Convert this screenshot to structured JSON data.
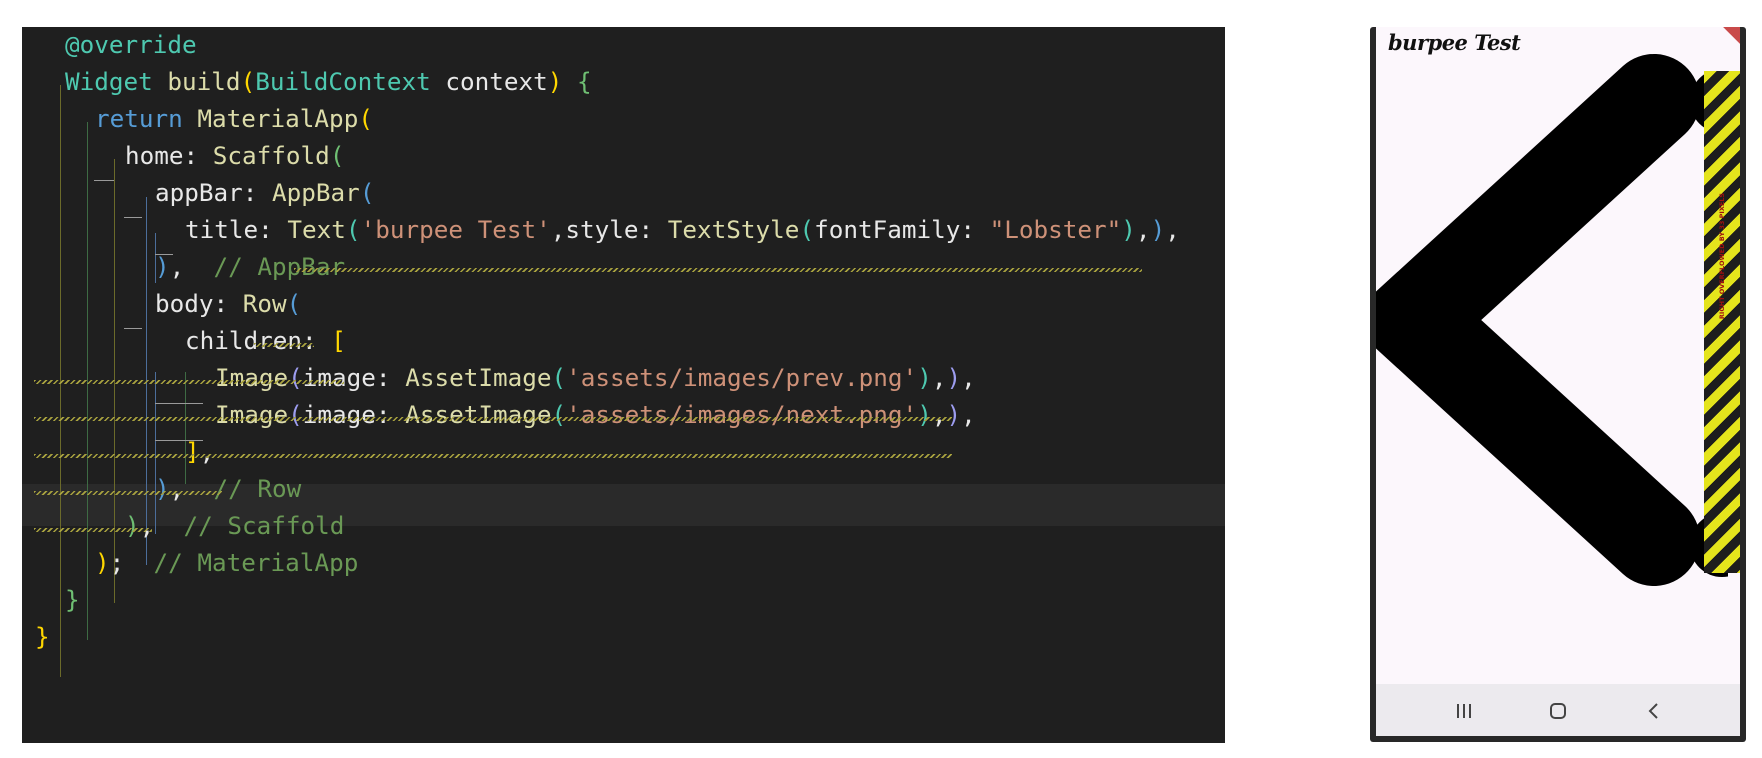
{
  "editor": {
    "lines": [
      {
        "tokens": [
          {
            "t": "@override",
            "c": "at"
          }
        ]
      },
      {
        "tokens": [
          {
            "t": "Widget",
            "c": "ty"
          },
          {
            "t": " build",
            "c": "fn"
          },
          {
            "t": "(",
            "c": "p1"
          },
          {
            "t": "BuildContext",
            "c": "ty"
          },
          {
            "t": " context",
            "c": "id"
          },
          {
            "t": ")",
            "c": "p1"
          },
          {
            "t": " {",
            "c": "p3"
          }
        ]
      },
      {
        "tokens": [
          {
            "t": "return",
            "c": "kw2"
          },
          {
            "t": " MaterialApp",
            "c": "fn"
          },
          {
            "t": "(",
            "c": "p1"
          }
        ]
      },
      {
        "tokens": [
          {
            "t": "home",
            "c": "id"
          },
          {
            "t": ": ",
            "c": "id"
          },
          {
            "t": "Scaffold",
            "c": "fn"
          },
          {
            "t": "(",
            "c": "p3"
          }
        ]
      },
      {
        "tokens": [
          {
            "t": "appBar",
            "c": "id"
          },
          {
            "t": ": ",
            "c": "id"
          },
          {
            "t": "AppBar",
            "c": "fn"
          },
          {
            "t": "(",
            "c": "p2"
          }
        ]
      },
      {
        "tokens": [
          {
            "t": "title",
            "c": "id"
          },
          {
            "t": ": ",
            "c": "id"
          },
          {
            "t": "Text",
            "c": "fn"
          },
          {
            "t": "(",
            "c": "p6"
          },
          {
            "t": "'burpee Test'",
            "c": "st"
          },
          {
            "t": ",",
            "c": "id"
          },
          {
            "t": "style",
            "c": "id"
          },
          {
            "t": ": ",
            "c": "id"
          },
          {
            "t": "TextStyle",
            "c": "fn"
          },
          {
            "t": "(",
            "c": "p6"
          },
          {
            "t": "fontFamily",
            "c": "id"
          },
          {
            "t": ": ",
            "c": "id"
          },
          {
            "t": "\"Lobster\"",
            "c": "st"
          },
          {
            "t": ")",
            "c": "p6"
          },
          {
            "t": ",",
            "c": "id"
          },
          {
            "t": ")",
            "c": "p2"
          },
          {
            "t": ",",
            "c": "id"
          }
        ]
      },
      {
        "tokens": [
          {
            "t": ")",
            "c": "p2"
          },
          {
            "t": ",  ",
            "c": "id"
          },
          {
            "t": "// AppBar",
            "c": "cm"
          }
        ]
      },
      {
        "tokens": [
          {
            "t": "body",
            "c": "id"
          },
          {
            "t": ": ",
            "c": "id"
          },
          {
            "t": "Row",
            "c": "fn"
          },
          {
            "t": "(",
            "c": "p2"
          }
        ]
      },
      {
        "tokens": [
          {
            "t": "children",
            "c": "id"
          },
          {
            "t": ": ",
            "c": "id"
          },
          {
            "t": "[",
            "c": "p1"
          }
        ]
      },
      {
        "tokens": [
          {
            "t": "Image",
            "c": "fn"
          },
          {
            "t": "(",
            "c": "p5"
          },
          {
            "t": "image",
            "c": "id"
          },
          {
            "t": ": ",
            "c": "id"
          },
          {
            "t": "AssetImage",
            "c": "fn"
          },
          {
            "t": "(",
            "c": "p6"
          },
          {
            "t": "'assets/images/prev.png'",
            "c": "st"
          },
          {
            "t": ")",
            "c": "p6"
          },
          {
            "t": ",",
            "c": "id"
          },
          {
            "t": ")",
            "c": "p5"
          },
          {
            "t": ",",
            "c": "id"
          }
        ]
      },
      {
        "tokens": [
          {
            "t": "Image",
            "c": "fn"
          },
          {
            "t": "(",
            "c": "p5"
          },
          {
            "t": "image",
            "c": "id"
          },
          {
            "t": ": ",
            "c": "id"
          },
          {
            "t": "AssetImage",
            "c": "fn"
          },
          {
            "t": "(",
            "c": "p6"
          },
          {
            "t": "'assets/images/next.png'",
            "c": "st"
          },
          {
            "t": ")",
            "c": "p6"
          },
          {
            "t": ",",
            "c": "id"
          },
          {
            "t": ")",
            "c": "p5"
          },
          {
            "t": ",",
            "c": "id"
          }
        ]
      },
      {
        "tokens": [
          {
            "t": "]",
            "c": "p1"
          },
          {
            "t": ",",
            "c": "id"
          }
        ]
      },
      {
        "tokens": [
          {
            "t": ")",
            "c": "p2"
          },
          {
            "t": ",  ",
            "c": "id"
          },
          {
            "t": "// Row",
            "c": "cm"
          }
        ]
      },
      {
        "tokens": [
          {
            "t": ")",
            "c": "p3"
          },
          {
            "t": ",  ",
            "c": "id"
          },
          {
            "t": "// Scaffold",
            "c": "cm"
          }
        ]
      },
      {
        "tokens": [
          {
            "t": ")",
            "c": "p1"
          },
          {
            "t": ";  ",
            "c": "id"
          },
          {
            "t": "// MaterialApp",
            "c": "cm"
          }
        ]
      },
      {
        "tokens": [
          {
            "t": "}",
            "c": "p3"
          }
        ]
      },
      {
        "tokens": [
          {
            "t": "}",
            "c": "p1"
          }
        ]
      }
    ]
  },
  "phone": {
    "app_title": "burpee Test",
    "overflow_warning": "RIGHT OVERFLOWED BY 33 PIXELS",
    "prev_image_icon": "chevron-left-icon",
    "nav_buttons": [
      "recent-apps-icon",
      "home-icon",
      "back-icon"
    ]
  },
  "colors": {
    "editor_bg": "#1f1f1f",
    "overflow_yellow": "#e4e41c",
    "overflow_black": "#1d1d1d",
    "debug_banner": "#c94a4a"
  }
}
